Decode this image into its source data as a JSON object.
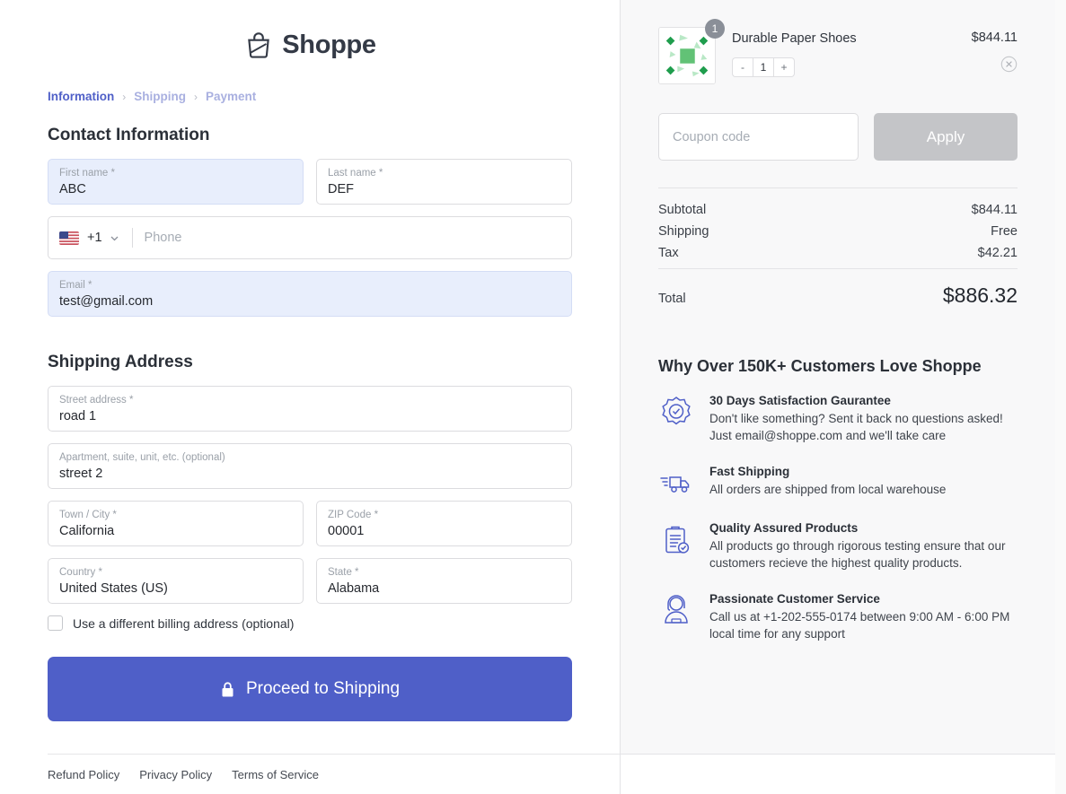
{
  "brand": {
    "name": "Shoppe",
    "logo_icon": "shopping-bag-icon"
  },
  "breadcrumb": {
    "step1": "Information",
    "sep1": "›",
    "step2": "Shipping",
    "sep2": "›",
    "step3": "Payment"
  },
  "contact": {
    "title": "Contact Information",
    "first_name": {
      "label": "First name *",
      "value": "ABC"
    },
    "last_name": {
      "label": "Last name *",
      "value": "DEF"
    },
    "phone": {
      "dial_code": "+1",
      "placeholder": "Phone",
      "flag_icon": "us-flag-icon",
      "chevron_icon": "chevron-down-icon"
    },
    "email": {
      "label": "Email *",
      "value": "test@gmail.com"
    }
  },
  "shipping": {
    "title": "Shipping Address",
    "street": {
      "label": "Street address *",
      "value": "road 1"
    },
    "apartment": {
      "label": "Apartment, suite, unit, etc. (optional)",
      "value": "street 2"
    },
    "city": {
      "label": "Town / City *",
      "value": "California"
    },
    "zip": {
      "label": "ZIP Code *",
      "value": "00001"
    },
    "country": {
      "label": "Country *",
      "value": "United States (US)"
    },
    "state": {
      "label": "State *",
      "value": "Alabama"
    },
    "billing_checkbox_label": "Use a different billing address (optional)"
  },
  "submit": {
    "label": "Proceed to Shipping",
    "icon": "lock-icon",
    "color": "#4f5fc8"
  },
  "footer": {
    "links": [
      "Refund Policy",
      "Privacy Policy",
      "Terms of Service"
    ]
  },
  "cart": {
    "item": {
      "name": "Durable Paper Shoes",
      "price": "$844.11",
      "quantity_badge": "1",
      "stepper": {
        "decrement": "-",
        "value": "1",
        "increment": "+"
      },
      "remove_icon": "remove-circle-icon",
      "thumbnail_icon": "product-pattern-thumbnail"
    },
    "coupon": {
      "placeholder": "Coupon code",
      "value": "",
      "apply_label": "Apply",
      "apply_disabled": true
    },
    "totals": [
      {
        "label": "Subtotal",
        "value": "$844.11"
      },
      {
        "label": "Shipping",
        "value": "Free"
      },
      {
        "label": "Tax",
        "value": "$42.21"
      }
    ],
    "grand_total": {
      "label": "Total",
      "value": "$886.32"
    }
  },
  "why": {
    "title": "Why Over 150K+ Customers Love Shoppe",
    "items": [
      {
        "icon": "badge-check-icon",
        "heading": "30 Days Satisfaction Gaurantee",
        "line1": "Don't like something? Sent it back no questions asked!",
        "line2": "Just email@shoppe.com and we'll take care"
      },
      {
        "icon": "delivery-truck-icon",
        "heading": "Fast Shipping",
        "line1": "All orders are shipped from local warehouse",
        "line2": ""
      },
      {
        "icon": "clipboard-check-icon",
        "heading": "Quality Assured Products",
        "line1": "All products go through rigorous testing ensure that our",
        "line2": "customers recieve the highest quality products."
      },
      {
        "icon": "headset-agent-icon",
        "heading": "Passionate Customer Service",
        "line1": "Call us at +1-202-555-0174 between 9:00 AM - 6:00 PM",
        "line2": "local time for any support"
      }
    ]
  }
}
